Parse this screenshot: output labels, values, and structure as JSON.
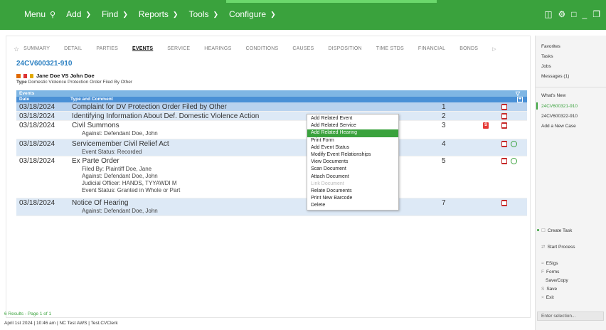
{
  "topbar": {
    "menu_label": "Menu",
    "add_label": "Add",
    "find_label": "Find",
    "reports_label": "Reports",
    "tools_label": "Tools",
    "configure_label": "Configure",
    "brand_color": "#3aa23d"
  },
  "tabs": [
    "SUMMARY",
    "DETAIL",
    "PARTIES",
    "EVENTS",
    "SERVICE",
    "HEARINGS",
    "CONDITIONS",
    "CAUSES",
    "DISPOSITION",
    "TIME STDS",
    "FINANCIAL",
    "BONDS"
  ],
  "active_tab": "EVENTS",
  "case": {
    "number": "24CV600321-910",
    "title": "Jane Doe VS John Doe",
    "type_label": "Type",
    "type_value": "Domestic Violence Protection Order Filed By Other"
  },
  "grid": {
    "panel_title": "Events",
    "col_date": "Date",
    "col_type": "Type and Comment",
    "rows": [
      {
        "date": "03/18/2024",
        "title": "Complaint for DV Protection Order Filed by Other",
        "sub": [],
        "num": "1"
      },
      {
        "date": "03/18/2024",
        "title": "Identifying Information About Def. Domestic Violence Action",
        "sub": [],
        "num": "2"
      },
      {
        "date": "03/18/2024",
        "title": "Civil Summons",
        "sub": [
          "Against: Defendant  Doe, John"
        ],
        "num": "3"
      },
      {
        "date": "03/18/2024",
        "title": "Servicemember Civil Relief Act",
        "sub": [
          "Event Status: Recorded"
        ],
        "num": "4"
      },
      {
        "date": "03/18/2024",
        "title": "Ex Parte Order",
        "sub": [
          "Filed By: Plaintiff  Doe, Jane",
          "Against: Defendant  Doe, John",
          "Judicial Officer: HANDS, TYYAWDI M",
          "Event Status: Granted in Whole or Part"
        ],
        "num": "5"
      },
      {
        "date": "03/18/2024",
        "title": "Notice Of Hearing",
        "sub": [
          "Against: Defendant  Doe, John"
        ],
        "num": "7"
      }
    ]
  },
  "context_menu": [
    {
      "label": "Add Related Event",
      "state": "normal"
    },
    {
      "label": "Add Related Service",
      "state": "normal"
    },
    {
      "label": "Add Related Hearing",
      "state": "highlighted"
    },
    {
      "label": "Print Form",
      "state": "normal"
    },
    {
      "label": "Add Event Status",
      "state": "normal"
    },
    {
      "label": "Modify Event Relationships",
      "state": "normal"
    },
    {
      "label": "View Documents",
      "state": "normal"
    },
    {
      "label": "Scan Document",
      "state": "normal"
    },
    {
      "label": "Attach Document",
      "state": "normal"
    },
    {
      "label": "Link Document",
      "state": "disabled"
    },
    {
      "label": "Relate Documents",
      "state": "normal"
    },
    {
      "label": "Print New Barcode",
      "state": "normal"
    },
    {
      "label": "Delete",
      "state": "normal"
    }
  ],
  "status": {
    "results": "6 Results - Page 1 of 1",
    "footer": "April 1st 2024 | 10:46 am | NC Test AWS | Test.CVClerk"
  },
  "rpanel": {
    "favorites": "Favorites",
    "tasks": "Tasks",
    "jobs": "Jobs",
    "messages": "Messages (1)",
    "whats_new": "What's New",
    "recent1": "24CV600321-910",
    "recent2": "24CV600322-910",
    "add_case": "Add a New Case",
    "create_task": "Create Task",
    "start_process": "Start Process",
    "esigs": "ESigs",
    "forms": "Forms",
    "save_copy": "Save/Copy",
    "save": "Save",
    "exit": "Exit",
    "enter_selection": "Enter selection..."
  }
}
